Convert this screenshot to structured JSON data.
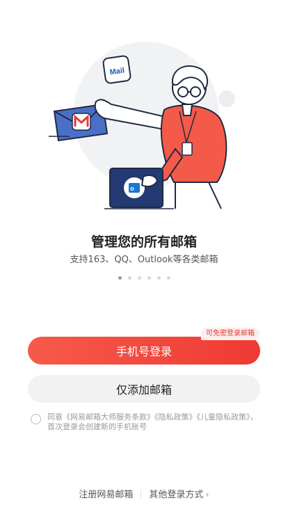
{
  "colors": {
    "accent": "#ef3a34",
    "badge_bg": "#fdeeee"
  },
  "onboarding": {
    "title": "管理您的所有邮箱",
    "subtitle": "支持163、QQ、Outlook等各类邮箱",
    "page_count": 6,
    "active_page": 1,
    "mail_icon_text": "Mail"
  },
  "login": {
    "badge": "可免密登录邮箱",
    "phone_login_label": "手机号登录",
    "add_mailbox_label": "仅添加邮箱"
  },
  "agreement": {
    "text": "同意《网易邮箱大师服务条款》《隐私政策》《儿童隐私政策》，首次登录会创建新的手机账号",
    "checked": false
  },
  "footer": {
    "register_label": "注册网易邮箱",
    "other_login_label": "其他登录方式",
    "chevron_icon": "chevron-right-icon"
  }
}
